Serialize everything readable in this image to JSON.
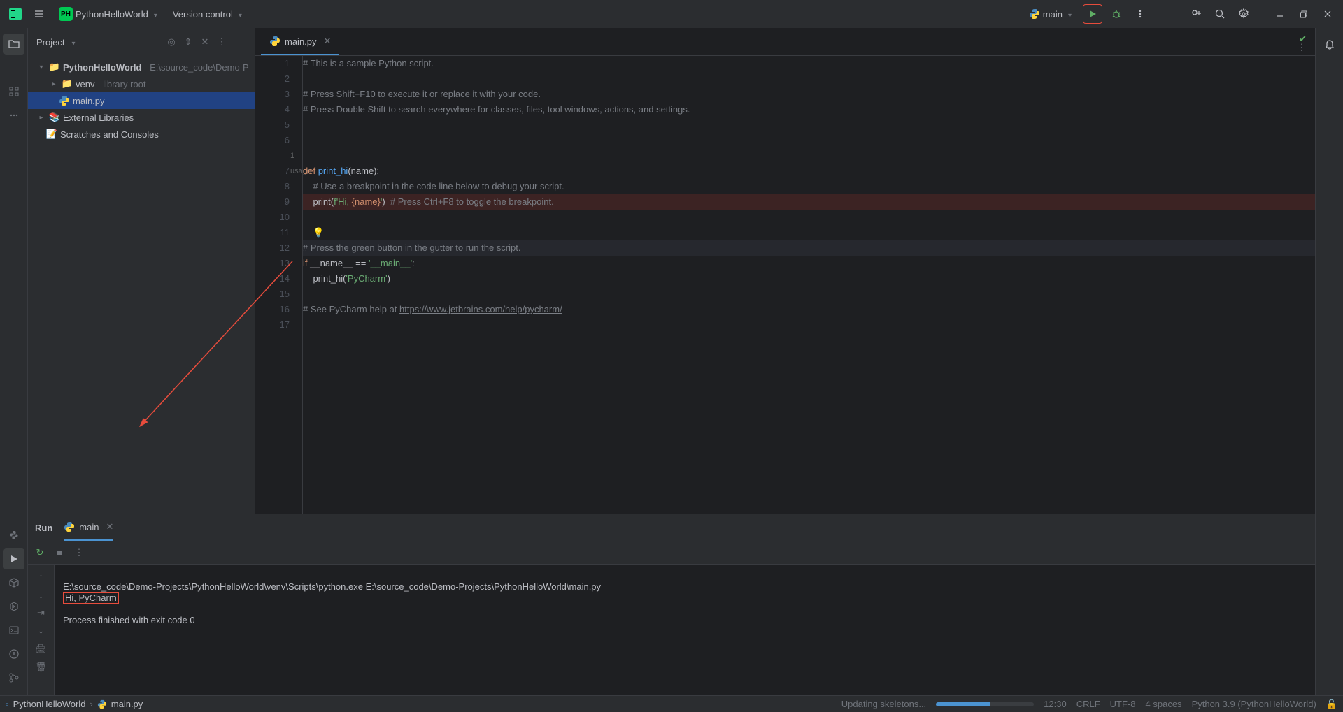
{
  "titlebar": {
    "project_badge": "PH",
    "project_name": "PythonHelloWorld",
    "vcs_menu": "Version control",
    "run_config": "main"
  },
  "project_panel": {
    "title": "Project",
    "root": "PythonHelloWorld",
    "root_path": "E:\\source_code\\Demo-P",
    "venv": "venv",
    "venv_hint": "library root",
    "main_file": "main.py",
    "ext_libs": "External Libraries",
    "scratches": "Scratches and Consoles"
  },
  "editor": {
    "tab": "main.py",
    "usage_hint": "1 usage",
    "lines": {
      "l1": "# This is a sample Python script.",
      "l3": "# Press Shift+F10 to execute it or replace it with your code.",
      "l4": "# Press Double Shift to search everywhere for classes, files, tool windows, actions, and settings.",
      "l7_def": "def ",
      "l7_fn": "print_hi",
      "l7_rest": "(name):",
      "l8": "    # Use a breakpoint in the code line below to debug your script.",
      "l9a": "    print(",
      "l9b": "f'Hi, ",
      "l9c": "{name}",
      "l9d": "'",
      "l9e": ")  ",
      "l9f": "# Press Ctrl+F8 to toggle the breakpoint.",
      "l12": "# Press the green button in the gutter to run the script.",
      "l13a": "if ",
      "l13b": "__name__ == ",
      "l13c": "'__main__'",
      "l13d": ":",
      "l14a": "    print_hi(",
      "l14b": "'PyCharm'",
      "l14c": ")",
      "l16a": "# See PyCharm help at ",
      "l16b": "https://www.jetbrains.com/help/pycharm/"
    }
  },
  "run_panel": {
    "title": "Run",
    "tab": "main",
    "output_cmd": "E:\\source_code\\Demo-Projects\\PythonHelloWorld\\venv\\Scripts\\python.exe E:\\source_code\\Demo-Projects\\PythonHelloWorld\\main.py",
    "output_hi": "Hi, PyCharm",
    "output_exit": "Process finished with exit code 0"
  },
  "status": {
    "crumb_proj": "PythonHelloWorld",
    "crumb_file": "main.py",
    "task": "Updating skeletons...",
    "pos": "12:30",
    "eol": "CRLF",
    "enc": "UTF-8",
    "indent": "4 spaces",
    "interp": "Python 3.9 (PythonHelloWorld)"
  }
}
